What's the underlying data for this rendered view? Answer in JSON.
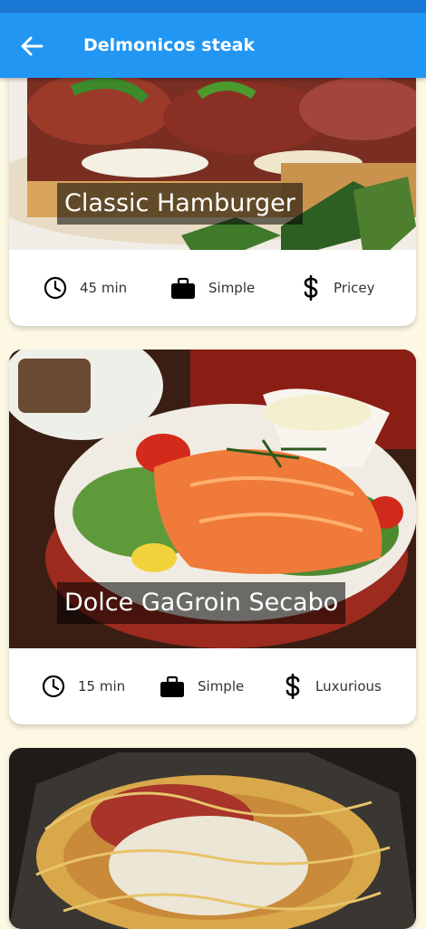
{
  "app_bar": {
    "title": "Delmonicos steak",
    "back_icon": "arrow-back-icon",
    "color": "#2196f3"
  },
  "meals": [
    {
      "title": "Classic Hamburger",
      "duration": "45 min",
      "complexity": "Simple",
      "affordability": "Pricey"
    },
    {
      "title": "Dolce GaGroin Secabo",
      "duration": "15 min",
      "complexity": "Simple",
      "affordability": "Luxurious"
    },
    {
      "title": "",
      "duration": "",
      "complexity": "",
      "affordability": ""
    }
  ],
  "icons": {
    "duration": "clock-icon",
    "complexity": "briefcase-icon",
    "affordability": "dollar-icon"
  }
}
